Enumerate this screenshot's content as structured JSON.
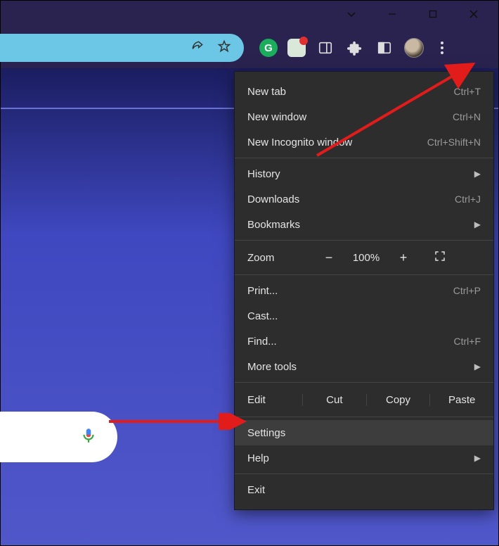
{
  "menu": {
    "new_tab": {
      "label": "New tab",
      "shortcut": "Ctrl+T"
    },
    "new_window": {
      "label": "New window",
      "shortcut": "Ctrl+N"
    },
    "new_incognito": {
      "label": "New Incognito window",
      "shortcut": "Ctrl+Shift+N"
    },
    "history": {
      "label": "History"
    },
    "downloads": {
      "label": "Downloads",
      "shortcut": "Ctrl+J"
    },
    "bookmarks": {
      "label": "Bookmarks"
    },
    "zoom": {
      "label": "Zoom",
      "value": "100%",
      "minus": "−",
      "plus": "+"
    },
    "print": {
      "label": "Print...",
      "shortcut": "Ctrl+P"
    },
    "cast": {
      "label": "Cast..."
    },
    "find": {
      "label": "Find...",
      "shortcut": "Ctrl+F"
    },
    "more_tools": {
      "label": "More tools"
    },
    "edit": {
      "label": "Edit",
      "cut": "Cut",
      "copy": "Copy",
      "paste": "Paste"
    },
    "settings": {
      "label": "Settings"
    },
    "help": {
      "label": "Help"
    },
    "exit": {
      "label": "Exit"
    }
  },
  "toolbar": {
    "grammarly_glyph": "G"
  }
}
